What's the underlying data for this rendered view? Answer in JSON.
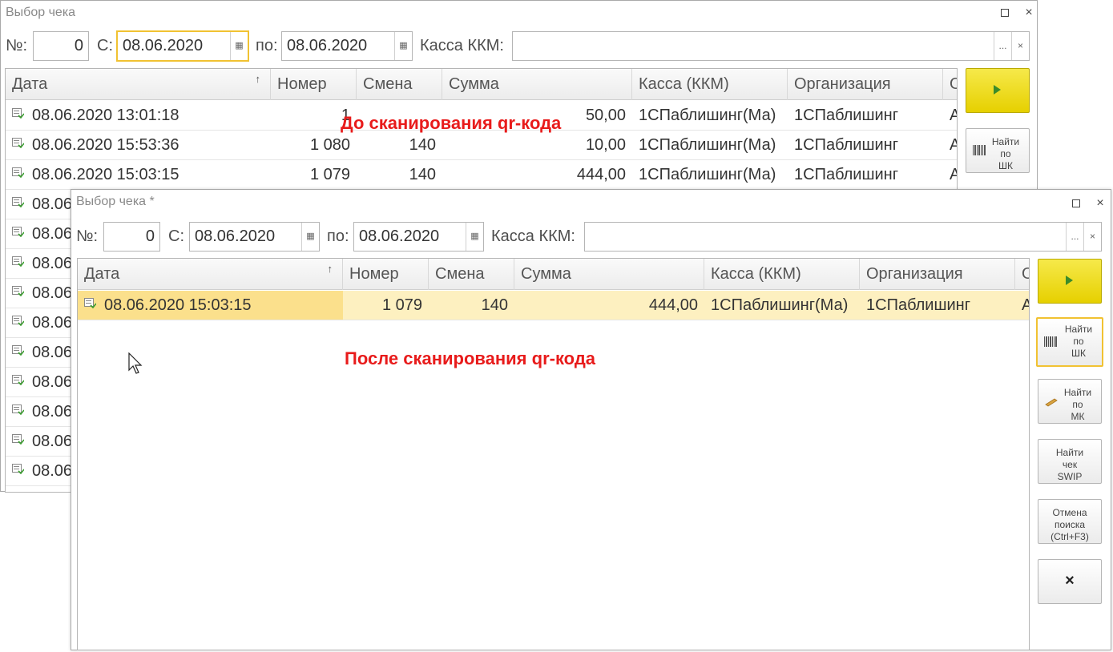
{
  "window_back": {
    "title": "Выбор чека",
    "filter": {
      "num_label": "№:",
      "num_value": "0",
      "from_label": "С:",
      "from_value": "08.06.2020",
      "to_label": "по:",
      "to_value": "08.06.2020",
      "kassa_label": "Касса ККМ:",
      "kassa_value": ""
    },
    "columns": [
      "Дата",
      "Номер",
      "Смена",
      "Сумма",
      "Касса (ККМ)",
      "Организация",
      "О"
    ],
    "rows": [
      {
        "date": "08.06.2020 13:01:18",
        "num": "1",
        "shift": "",
        "sum": "50,00",
        "kassa": "1СПаблишинг(Ма)",
        "org": "1СПаблишинг",
        "extra": "А"
      },
      {
        "date": "08.06.2020 15:53:36",
        "num": "1 080",
        "shift": "140",
        "sum": "10,00",
        "kassa": "1СПаблишинг(Ма)",
        "org": "1СПаблишинг",
        "extra": "А"
      },
      {
        "date": "08.06.2020 15:03:15",
        "num": "1 079",
        "shift": "140",
        "sum": "444,00",
        "kassa": "1СПаблишинг(Ма)",
        "org": "1СПаблишинг",
        "extra": "А"
      }
    ],
    "partial_rows": [
      "08.06",
      "08.06",
      "08.06",
      "08.06",
      "08.06",
      "08.06",
      "08.06",
      "08.06",
      "08.06",
      "08.06"
    ],
    "find_barcode": [
      "Найти",
      "по",
      "ШК"
    ],
    "annotation": "До сканирования qr-кода"
  },
  "window_front": {
    "title": "Выбор чека *",
    "filter": {
      "num_label": "№:",
      "num_value": "0",
      "from_label": "С:",
      "from_value": "08.06.2020",
      "to_label": "по:",
      "to_value": "08.06.2020",
      "kassa_label": "Касса ККМ:",
      "kassa_value": ""
    },
    "columns": [
      "Дата",
      "Номер",
      "Смена",
      "Сумма",
      "Касса (ККМ)",
      "Организация",
      "О"
    ],
    "rows": [
      {
        "date": "08.06.2020 15:03:15",
        "num": "1 079",
        "shift": "140",
        "sum": "444,00",
        "kassa": "1СПаблишинг(Ма)",
        "org": "1СПаблишинг",
        "extra": "А"
      }
    ],
    "buttons": {
      "find_barcode": [
        "Найти",
        "по",
        "ШК"
      ],
      "find_mk": [
        "Найти",
        "по",
        "МК"
      ],
      "find_swip": [
        "Найти",
        "чек",
        "SWIP"
      ],
      "cancel_search": [
        "Отмена",
        "поиска",
        "(Ctrl+F3)"
      ],
      "close": "×"
    },
    "annotation": "После сканирования qr-кода"
  },
  "ellipsis": "...",
  "clear": "×",
  "sort_arrow": "↑",
  "calendar_glyph": "▦",
  "window_close": "×",
  "colors": {
    "accent_yellow": "#f1c232",
    "annotation_red": "#e81b1b",
    "selected_row": "#fdf0c0"
  }
}
